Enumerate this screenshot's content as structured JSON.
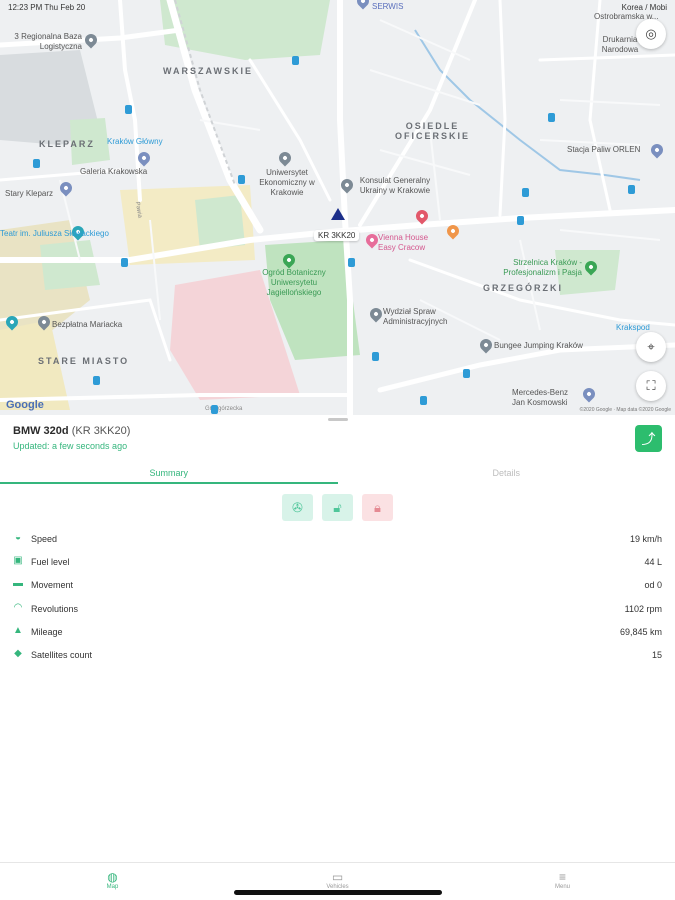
{
  "status": {
    "time": "12:23 PM  Thu Feb 20",
    "right": "Korea / Mobi"
  },
  "map": {
    "districts": [
      "WARSZAWSKIE",
      "OSIEDLE OFICERSKIE",
      "KLEPARZ",
      "GRZEGÓRZKI",
      "STARE MIASTO"
    ],
    "places": {
      "baza": "3 Regionalna Baza Logistyczna",
      "serwis": "SERWIS",
      "ostrobramska": "Ostrobramska w...",
      "drukarnia": "Drukarnia Narodowa",
      "krakow_glowny": "Kraków Główny",
      "stacja": "Stacja Paliw ORLEN",
      "galeria": "Galeria Krakowska",
      "uniwersytet": "Uniwersytet Ekonomiczny w Krakowie",
      "konsulat": "Konsulat Generalny Ukrainy w Krakowie",
      "stary_kleparz": "Stary Kleparz",
      "vienna": "Vienna House Easy Cracow",
      "teatr": "Teatr im. Juliusza Słowackiego",
      "ogrod": "Ogród Botaniczny Uniwersytetu Jagiellońskiego",
      "strzelnica": "Strzelnica Kraków - Profesjonalizm i Pasja",
      "biblioteka": "Bezpłatna Mariacka",
      "wydzial": "Wydział Spraw Administracyjnych",
      "krakspod": "Krakspod",
      "bungee": "Bungee Jumping Kraków",
      "mercedes": "Mercedes-Benz Jan Kosmowski",
      "grzegorzecka": "Grzegórzecka",
      "pawia": "Pawia"
    },
    "plate_tag": "KR 3KK20",
    "google": "Google",
    "attribution": "©2020 Google · Map data ©2020 Google"
  },
  "vehicle": {
    "name": "BMW 320d",
    "plate": "(KR 3KK20)",
    "updated": "Updated: a few seconds ago"
  },
  "tabs": [
    {
      "label": "Summary"
    },
    {
      "label": "Details"
    }
  ],
  "metrics": [
    {
      "icon": "speed-icon",
      "label": "Speed",
      "value": "19 km/h"
    },
    {
      "icon": "fuel-icon",
      "label": "Fuel level",
      "value": "44 L"
    },
    {
      "icon": "car-icon",
      "label": "Movement",
      "value": "od 0"
    },
    {
      "icon": "gauge-icon",
      "label": "Revolutions",
      "value": "1102 rpm"
    },
    {
      "icon": "road-icon",
      "label": "Mileage",
      "value": "69,845 km"
    },
    {
      "icon": "satellite-icon",
      "label": "Satellites count",
      "value": "15"
    }
  ],
  "nav": [
    {
      "icon": "globe-icon",
      "label": "Map"
    },
    {
      "icon": "vehicle-icon",
      "label": "Vehicles"
    },
    {
      "icon": "menu-icon",
      "label": "Menu"
    }
  ],
  "colors": {
    "accent": "#35b67d",
    "route_button": "#2dbd6e",
    "marker": "#1c2f8a"
  }
}
